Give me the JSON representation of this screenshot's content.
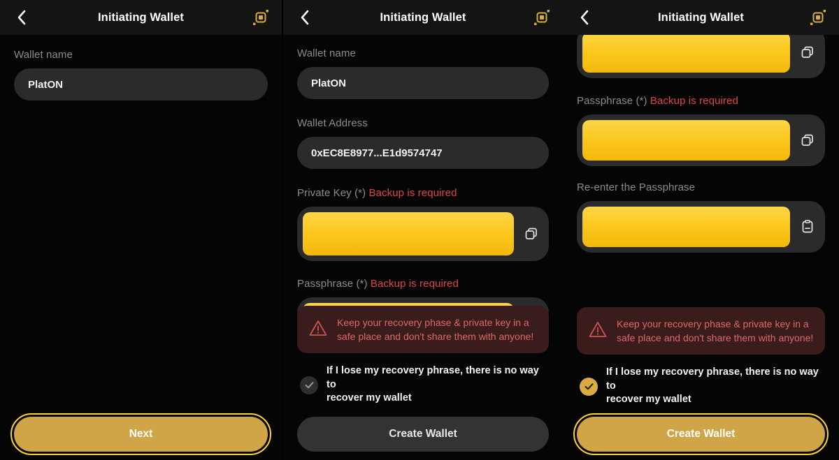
{
  "app": {
    "title": "Initiating Wallet",
    "colors": {
      "accent_gold": "#cfa547",
      "focus_ring": "#ffd22e",
      "secret_block": "#fbc91f",
      "warning_text": "#d96a66",
      "warning_bg": "#3b1c1c",
      "required_red": "#e04545",
      "header_bg": "#141414",
      "body_bg": "#050505",
      "input_bg": "#2b2b2b"
    },
    "icons": {
      "back": "chevron-left-icon",
      "scan": "qr-scan-icon",
      "copy": "copy-icon",
      "paste": "paste-clipboard-icon",
      "warning": "warning-triangle-icon",
      "check": "check-circle-icon"
    }
  },
  "shared": {
    "warning_line1": "Keep your recovery phase & private key in a",
    "warning_line2": "safe place and don't share them with anyone!",
    "consent_line1": "If I lose my recovery phrase, there is no way to",
    "consent_line2": "recover my wallet"
  },
  "panels": [
    {
      "id": "panel-step-1",
      "header_title": "Initiating Wallet",
      "fields": [
        {
          "name": "wallet-name",
          "label": "Wallet name",
          "required_note": "",
          "type": "text",
          "value": "PlatON",
          "placeholder": "Wallet name"
        }
      ],
      "cta": {
        "label": "Next",
        "state": "primary-focused"
      }
    },
    {
      "id": "panel-step-2",
      "header_title": "Initiating Wallet",
      "fields": [
        {
          "name": "wallet-name",
          "label": "Wallet name",
          "required_note": "",
          "type": "text",
          "value": "PlatON",
          "placeholder": "Wallet name"
        },
        {
          "name": "wallet-address",
          "label": "Wallet Address",
          "required_note": "",
          "type": "text",
          "value": "0xEC8E8977...E1d9574747",
          "placeholder": "Wallet Address"
        },
        {
          "name": "private-key",
          "label": "Private Key (*)",
          "required_note": "Backup is required",
          "type": "secret",
          "value": "",
          "trailing_icon": "copy-icon"
        },
        {
          "name": "passphrase",
          "label": "Passphrase (*)",
          "required_note": "Backup is required",
          "type": "secret-clipped",
          "value": "",
          "trailing_icon": "copy-icon"
        }
      ],
      "consent_checked": false,
      "cta": {
        "label": "Create Wallet",
        "state": "disabled"
      }
    },
    {
      "id": "panel-step-3",
      "header_title": "Initiating Wallet",
      "scrolled": true,
      "fields": [
        {
          "name": "private-key",
          "label": "",
          "required_note": "",
          "type": "secret",
          "value": "",
          "trailing_icon": "copy-icon"
        },
        {
          "name": "passphrase",
          "label": "Passphrase (*)",
          "required_note": "Backup is required",
          "type": "secret",
          "value": "",
          "trailing_icon": "copy-icon"
        },
        {
          "name": "re-enter-passphrase",
          "label": "Re-enter the Passphrase",
          "required_note": "",
          "type": "secret",
          "value": "",
          "trailing_icon": "paste-clipboard-icon"
        }
      ],
      "consent_checked": true,
      "cta": {
        "label": "Create Wallet",
        "state": "primary-focused"
      }
    }
  ]
}
